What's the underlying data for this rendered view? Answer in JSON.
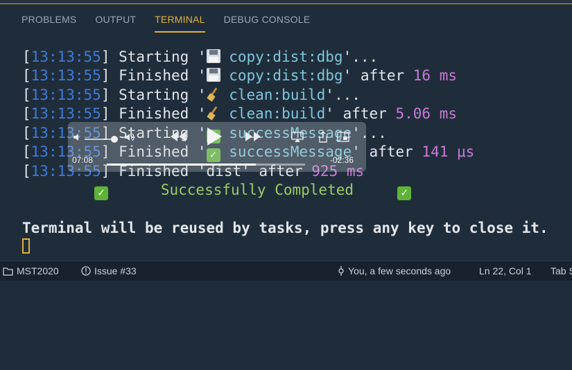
{
  "tabs": [
    {
      "label": "PROBLEMS"
    },
    {
      "label": "OUTPUT"
    },
    {
      "label": "TERMINAL"
    },
    {
      "label": "DEBUG CONSOLE"
    }
  ],
  "terminal": {
    "lines": [
      {
        "time": "13:13:55",
        "verb": "Starting",
        "icon": "floppy-disk-icon",
        "task": "copy:dist:dbg",
        "suffix": "'...",
        "after": "",
        "duration": ""
      },
      {
        "time": "13:13:55",
        "verb": "Finished",
        "icon": "floppy-disk-icon",
        "task": "copy:dist:dbg",
        "suffix": "'",
        "after": "after",
        "duration": "16 ms"
      },
      {
        "time": "13:13:55",
        "verb": "Starting",
        "icon": "broom-icon",
        "task": "clean:build",
        "suffix": "'...",
        "after": "",
        "duration": ""
      },
      {
        "time": "13:13:55",
        "verb": "Finished",
        "icon": "broom-icon",
        "task": "clean:build",
        "suffix": "'",
        "after": "after",
        "duration": "5.06 ms"
      },
      {
        "time": "13:13:55",
        "verb": "Starting",
        "icon": "check-mark-icon",
        "task": "successMessage",
        "suffix": "'...",
        "after": "",
        "duration": ""
      },
      {
        "time": "13:13:55",
        "verb": "Finished",
        "icon": "check-mark-icon",
        "task": "successMessage",
        "suffix": "'",
        "after": "after",
        "duration": "141 μs"
      }
    ],
    "dist_line": {
      "time": "13:13:55",
      "text": "Finished 'dist' after",
      "duration": "925 ms"
    },
    "success_text": "Successfully Completed",
    "reuse_message": "Terminal will be reused by tasks, press any key to close it."
  },
  "video_overlay": {
    "elapsed": "07:08",
    "remaining": "-02:36",
    "progress_fraction": 0.75
  },
  "statusbar": {
    "branch": "MST2020",
    "issue": "Issue #33",
    "blame": "You, a few seconds ago",
    "position": "Ln 22, Col 1",
    "indent": "Tab S"
  },
  "colors": {
    "background": "#1f2d3b",
    "accent": "#e2b13d",
    "timestamp": "#3f7bd6",
    "task": "#7fc6dc",
    "duration": "#cc79d7",
    "success": "#9ccc65"
  }
}
